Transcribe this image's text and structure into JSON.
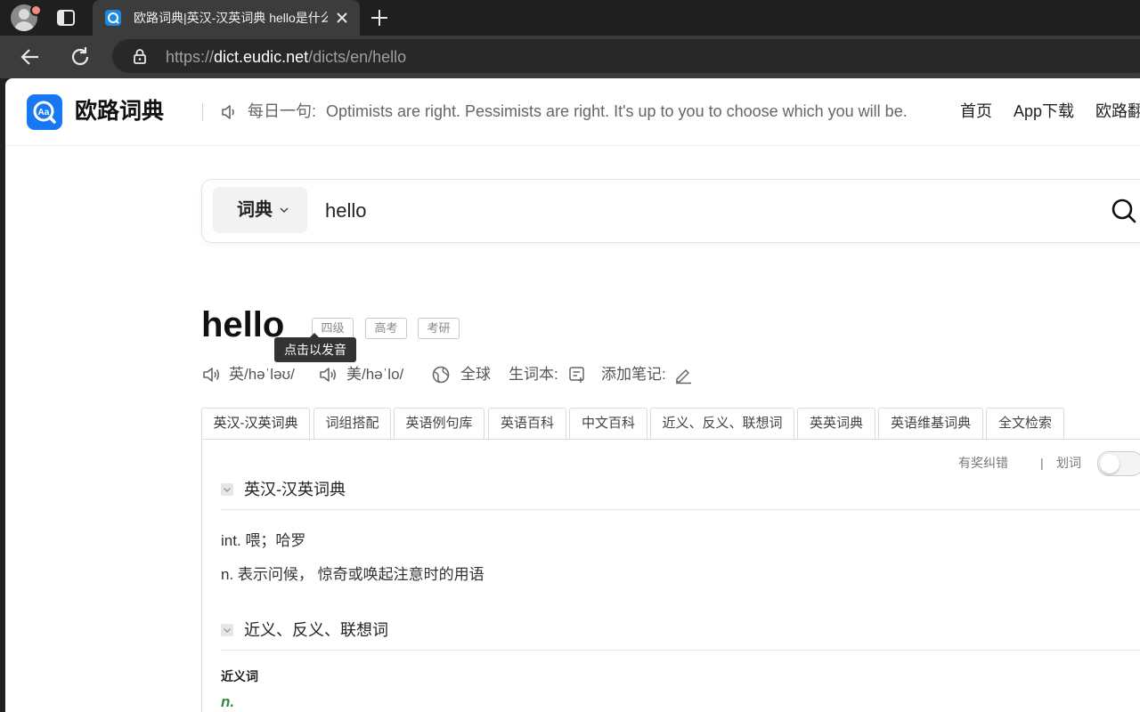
{
  "browser": {
    "tab_title": "欧路词典|英汉-汉英词典 hello是什么意思",
    "url_scheme": "https://",
    "url_host": "dict.eudic.net",
    "url_path": "/dicts/en/hello"
  },
  "header": {
    "logo_text": "欧路词典",
    "daily_prefix": "每日一句:",
    "daily_sentence": "Optimists are right. Pessimists are right. It's up to you to choose which you will be.",
    "nav": [
      "首页",
      "App下载",
      "欧路翻译"
    ]
  },
  "search": {
    "dict_label": "词典",
    "query": "hello"
  },
  "entry": {
    "word": "hello",
    "tags": [
      "四级",
      "高考",
      "考研"
    ],
    "tooltip": "点击以发音",
    "uk_pron": "英/həˈləʊ/",
    "us_pron": "美/həˈlo/",
    "global_label": "全球",
    "wordbook_label": "生词本:",
    "note_label": "添加笔记:"
  },
  "tabs": [
    "英汉-汉英词典",
    "词组搭配",
    "英语例句库",
    "英语百科",
    "中文百科",
    "近义、反义、联想词",
    "英英词典",
    "英语维基词典",
    "全文检索"
  ],
  "utilities": {
    "report": "有奖纠错",
    "divider": "|",
    "highlight": "划词"
  },
  "sections": {
    "dict_title": "英汉-汉英词典",
    "definitions": [
      "int. 喂；哈罗",
      "n. 表示问候， 惊奇或唤起注意时的用语"
    ],
    "related_title": "近义、反义、联想词",
    "synonyms_label": "近义词",
    "synonyms_pos": "n."
  },
  "colors": {
    "brand": "#1877f2",
    "pos_green": "#2e8b3e"
  }
}
